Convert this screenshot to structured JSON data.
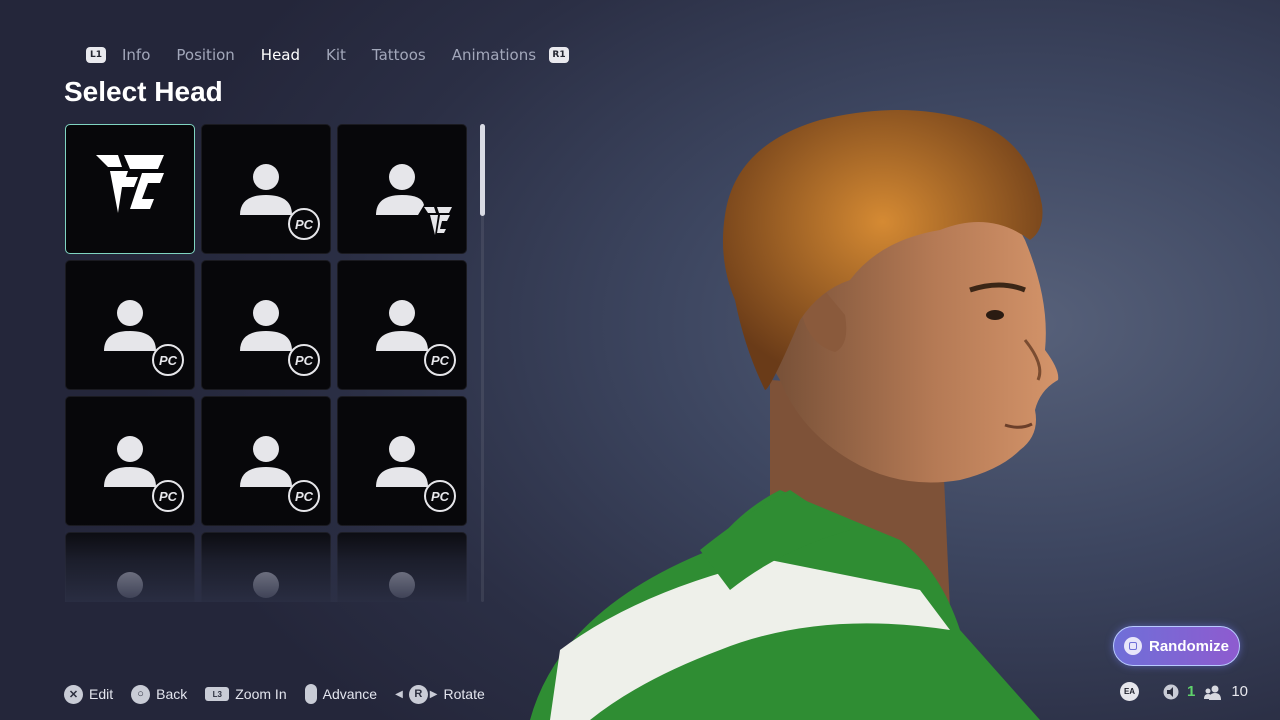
{
  "tabs": {
    "left_shoulder": "L1",
    "right_shoulder": "R1",
    "items": [
      "Info",
      "Position",
      "Head",
      "Kit",
      "Tattoos",
      "Animations"
    ],
    "active": "Head"
  },
  "page_title": "Select Head",
  "grid": {
    "tiles": [
      {
        "icon": "fc-logo-icon",
        "selected": true
      },
      {
        "icon": "person-pc-icon"
      },
      {
        "icon": "person-fc-icon"
      },
      {
        "icon": "person-pc-icon"
      },
      {
        "icon": "person-pc-icon"
      },
      {
        "icon": "person-pc-icon"
      },
      {
        "icon": "person-pc-icon"
      },
      {
        "icon": "person-pc-icon"
      },
      {
        "icon": "person-pc-icon"
      },
      {
        "icon": "person-icon"
      },
      {
        "icon": "person-icon"
      },
      {
        "icon": "person-icon"
      }
    ],
    "pc_badge_text": "PC"
  },
  "randomize_label": "Randomize",
  "footer": {
    "hints": [
      {
        "glyph": "✕",
        "label": "Edit"
      },
      {
        "glyph": "○",
        "label": "Back"
      },
      {
        "glyph": "L3",
        "label": "Zoom In"
      },
      {
        "glyph": "",
        "label": "Advance"
      },
      {
        "glyph": "R",
        "label": "Rotate"
      }
    ]
  },
  "status": {
    "ea_label": "EA",
    "voice_count": "1",
    "players_count": "10"
  },
  "colors": {
    "accent_selected": "#7fd4c1",
    "randomize_start": "#6f6fd8",
    "randomize_end": "#8e5bcf",
    "status_green": "#5fd36b"
  }
}
